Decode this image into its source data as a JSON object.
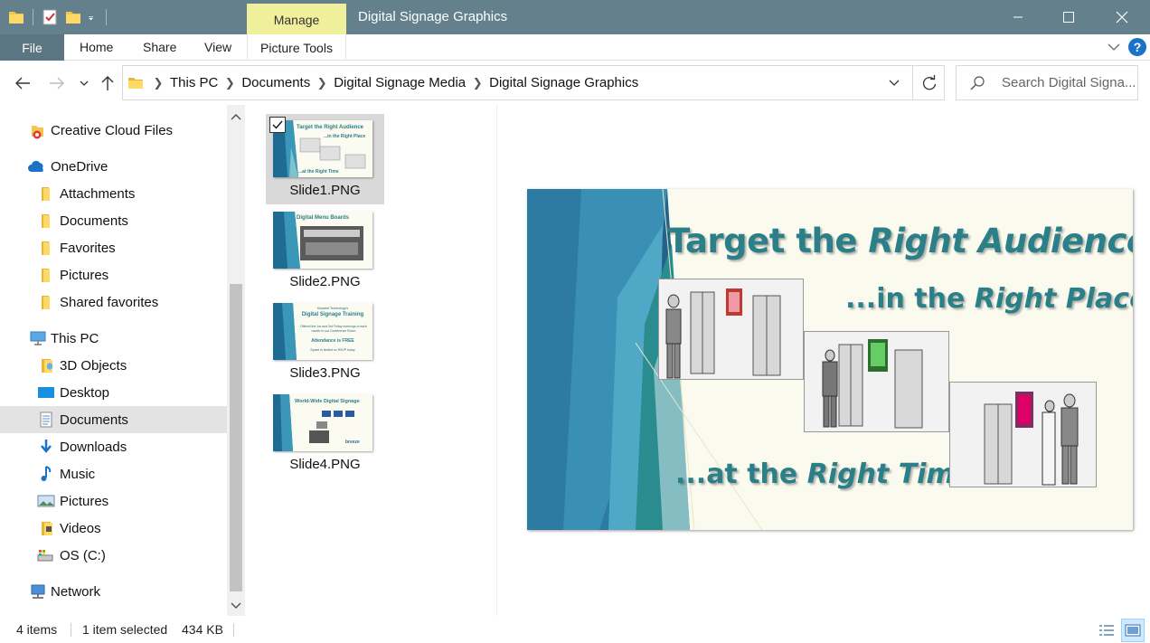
{
  "window": {
    "title": "Digital Signage Graphics",
    "contextual_tab": "Manage",
    "accent_titlebar": "#64808d",
    "accent_file_tab": "#5b7582",
    "accent_manage": "#f0ef9c"
  },
  "quick_access": [
    "folder-icon",
    "properties-icon",
    "new-folder-icon",
    "customize-qat-icon"
  ],
  "ribbon": {
    "file": "File",
    "tabs": [
      "Home",
      "Share",
      "View"
    ],
    "picture_tools": "Picture Tools"
  },
  "address": {
    "crumbs": [
      "This PC",
      "Documents",
      "Digital Signage Media",
      "Digital Signage Graphics"
    ],
    "search_placeholder": "Search Digital Signa..."
  },
  "nav": {
    "items": [
      {
        "label": "Creative Cloud Files",
        "icon": "creative-cloud-icon"
      },
      {
        "label": "OneDrive",
        "icon": "onedrive-icon"
      },
      {
        "label": "Attachments",
        "icon": "folder-icon"
      },
      {
        "label": "Documents",
        "icon": "folder-icon"
      },
      {
        "label": "Favorites",
        "icon": "folder-icon"
      },
      {
        "label": "Pictures",
        "icon": "folder-icon"
      },
      {
        "label": "Shared favorites",
        "icon": "folder-icon"
      },
      {
        "label": "This PC",
        "icon": "this-pc-icon"
      },
      {
        "label": "3D Objects",
        "icon": "3d-objects-icon"
      },
      {
        "label": "Desktop",
        "icon": "desktop-icon"
      },
      {
        "label": "Documents",
        "icon": "documents-icon",
        "selected": true
      },
      {
        "label": "Downloads",
        "icon": "downloads-icon"
      },
      {
        "label": "Music",
        "icon": "music-icon"
      },
      {
        "label": "Pictures",
        "icon": "pictures-icon"
      },
      {
        "label": "Videos",
        "icon": "videos-icon"
      },
      {
        "label": "OS (C:)",
        "icon": "drive-icon"
      },
      {
        "label": "Network",
        "icon": "network-icon"
      }
    ]
  },
  "files": [
    {
      "name": "Slide1.PNG",
      "selected": true,
      "thumb": {
        "title": "Target the Right Audience",
        "line2": "...in the Right Place",
        "line3": "...at the Right Time"
      }
    },
    {
      "name": "Slide2.PNG",
      "selected": false,
      "thumb": {
        "title": "Digital Menu Boards"
      }
    },
    {
      "name": "Slide3.PNG",
      "selected": false,
      "thumb": {
        "title": "Keywest Technology's",
        "line2": "Digital Signage Training",
        "line3": "Offered the 1st and 3rd Friday evenings of each month in our Conference Room",
        "line4": "Attendance is FREE",
        "line5": "Space is limited so RSVP today"
      }
    },
    {
      "name": "Slide4.PNG",
      "selected": false,
      "thumb": {
        "title": "World-Wide Digital Signage",
        "brand": "breeze"
      }
    }
  ],
  "preview": {
    "line1_a": "Target the ",
    "line1_b": "Right Audience",
    "line2_a": "...in the ",
    "line2_b": "Right Place",
    "line3_a": "...at the ",
    "line3_b": "Right Time",
    "text_color": "#2a7f88"
  },
  "status": {
    "items": "4 items",
    "selection": "1 item selected",
    "size": "434 KB"
  }
}
